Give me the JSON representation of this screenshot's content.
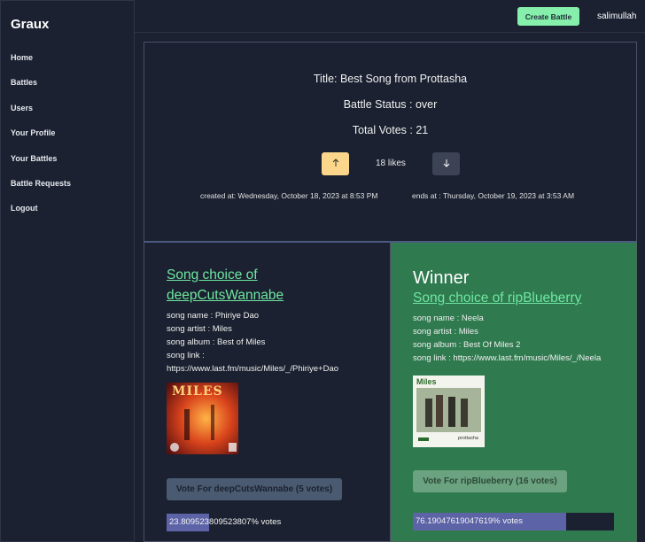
{
  "app": {
    "name": "Graux"
  },
  "sidebar": {
    "items": [
      {
        "label": "Home"
      },
      {
        "label": "Battles"
      },
      {
        "label": "Users"
      },
      {
        "label": "Your Profile"
      },
      {
        "label": "Your Battles"
      },
      {
        "label": "Battle Requests"
      },
      {
        "label": "Logout"
      }
    ]
  },
  "topbar": {
    "create_label": "Create Battle",
    "username": "salimullah"
  },
  "battle": {
    "title": "Title: Best Song from Prottasha",
    "status": "Battle Status : over",
    "total_votes": "Total Votes : 21",
    "likes": "18 likes",
    "upvote_icon": "arrow-up-icon",
    "downvote_icon": "arrow-down-icon",
    "created": "created at: Wednesday, October 18, 2023 at 8:53 PM",
    "ends": "ends at : Thursday, October 19, 2023 at 3:53 AM"
  },
  "entries": [
    {
      "heading_line1": "Song choice of",
      "heading_line2": "deepCutsWannabe",
      "song_name": "song name : Phiriye Dao",
      "song_artist": "song artist : Miles",
      "song_album": "song album : Best of Miles",
      "song_link_label": "song link :",
      "song_link_url": "https://www.last.fm/music/Miles/_/Phiriye+Dao",
      "album_text": "MILES",
      "vote_label": "Vote For deepCutsWannabe (5 votes)",
      "percent": 23.809523809523807,
      "percent_label": "23.809523809523807% votes"
    },
    {
      "winner_label": "Winner",
      "heading": "Song choice of ripBlueberry",
      "song_name": "song name : Neela",
      "song_artist": "song artist : Miles",
      "song_album": "song album : Best Of Miles 2",
      "song_link": "song link : https://www.last.fm/music/Miles/_/Neela",
      "album_text": "Miles",
      "album_subtext": "prottasha",
      "vote_label": "Vote For ripBlueberry (16 votes)",
      "percent": 76.19047619047619,
      "percent_label": "76.19047619047619% votes"
    }
  ],
  "colors": {
    "background": "#1b2130",
    "accent_green": "#86efac",
    "winner_bg": "#2f7a4f",
    "progress": "#5c63a6",
    "upvote": "#fcd68a"
  }
}
